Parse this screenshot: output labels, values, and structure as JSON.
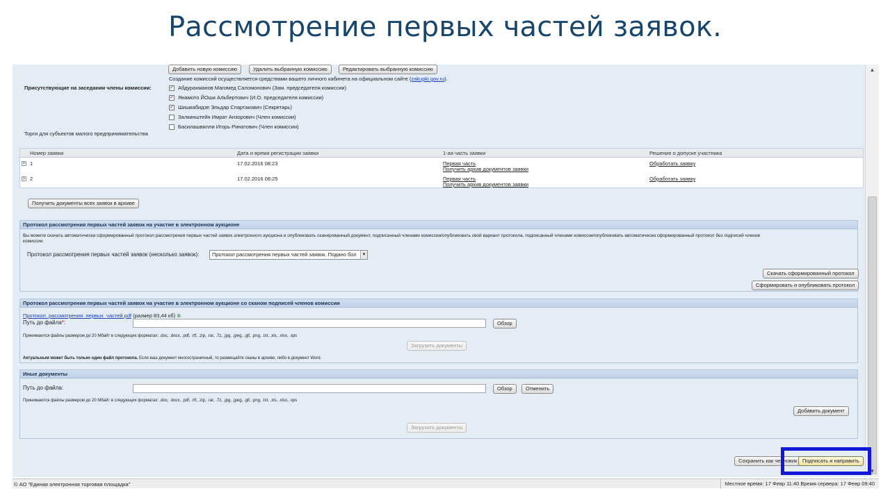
{
  "slide": {
    "title": "Рассмотрение первых частей заявок."
  },
  "commission": {
    "buttons": {
      "add": "Добавить новую комиссию",
      "delete": "Удалить выбранную комиссию",
      "edit": "Редактировать выбранную комиссию"
    },
    "note": "Создание комиссий осуществляется средствами вашего личного кабинета на официальном сайте (",
    "note_link": "zakupki.gov.ru",
    "note_end": ").",
    "members_label": "Присутствующие на заседании члены комиссии:",
    "members": [
      {
        "name": "Абдурахманов Магомед Саломонович (Зам. председателя комиссии)",
        "checked": "✓"
      },
      {
        "name": "Янамото ЙОши Альбертович (И.О. председателя комиссии)",
        "checked": "✓"
      },
      {
        "name": "Шишкабидзе Эльдар Спартакович (Секретарь)",
        "checked": "✓"
      },
      {
        "name": "Залкинштейн Имрат Анзорович (Член комиссии)",
        "checked": ""
      },
      {
        "name": "Басилашвилли Игорь Ринатович (Член комиссии)",
        "checked": ""
      }
    ],
    "smb_label": "Торги для субъектов малого предпринимательства"
  },
  "table": {
    "headers": [
      "Номер заявки",
      "Дата и время регистрации заявки",
      "1-ая часть заявки",
      "Решение о допуске участника"
    ],
    "rows": [
      {
        "expander": "+",
        "number": "1",
        "date": "17.02.2016 08:23",
        "part1": "Первая часть",
        "archive": "Получить архив документов заявки",
        "decision": "Обработать заявку"
      },
      {
        "expander": "+",
        "number": "2",
        "date": "17.02.2016 08:25",
        "part1": "Первая часть",
        "archive": "Получить архив документов заявки",
        "decision": "Обработать заявку"
      }
    ],
    "get_all_button": "Получить документы всех заявок в архиве"
  },
  "protocol_panel": {
    "title": "Протокол рассмотрения первых частей заявок на участие в электронном аукционе",
    "info_line1": "Вы можете скачать автоматически сформированный протокол рассмотрения первых частей заявок электронного аукциона и опубликовать сканированный документ, подписанный членами комиссии/опубликовать свой вариант протокола, подписанный членами комиссии/опубликовать автоматически сформированный протокол без подписей членов",
    "info_line2": "комиссии.",
    "select_label": "Протокол рассмотрения первых частей заявок (несколько заявок):",
    "select_value": "Протокол рассмотрения первых частей заявок. Подано бол",
    "download_button": "Скачать сформированный протокол",
    "publish_button": "Сформировать и опубликовать протокол"
  },
  "scan_panel": {
    "title": "Протокол рассмотрения первых частей заявок на участие в электронном аукционе со сканом подписей членов комиссии",
    "file_link": "Протокол_рассмотрения_первых_частей.pdf",
    "file_size": "(размер 83,44 кб)",
    "path_label": "Путь до файла",
    "required_mark": "*",
    "path_colon": ":",
    "browse_button": "Обзор",
    "formats_note": "Принимаются файлы размером до 20 Мбайт в следующих форматах: .doc, .docx, .pdf, .rtf, .zip, .rar, .7z, .jpg, .jpeg, .gif, .png, .txt, .xls, .xlsx, .xps",
    "upload_button": "Загрузить документы",
    "actual_bold": "Актуальным может быть только один файл протокола.",
    "actual_rest": " Если ваш документ многостраничный, то размещайте сканы в архиве, либо в документ Word."
  },
  "other_panel": {
    "title": "Иные документы",
    "path_label": "Путь до файла:",
    "browse_button": "Обзор",
    "cancel_button": "Отменить",
    "formats_note": "Принимаются файлы размером до 20 Мбайт в следующих форматах: .doc, .docx, .pdf, .rtf, .zip, .rar, .7z, .jpg, .jpeg, .gif, .png, .txt, .xls, .xlsx, .xps",
    "add_button": "Добавить документ",
    "upload_button": "Загрузить документы"
  },
  "actions": {
    "save_draft": "Сохранить как черновик",
    "sign_send": "Подписать и направить"
  },
  "footer": {
    "copyright": "© АО \"Единая электронная торговая площадка\"",
    "time": "Местное время: 17 Февр 11:40 Время сервера: 17 Февр 09:40"
  },
  "colors": {
    "title": "#17456b",
    "highlight": "#1217d6",
    "page_bg": "#e4ecf6",
    "link": "#1a3fb0"
  }
}
